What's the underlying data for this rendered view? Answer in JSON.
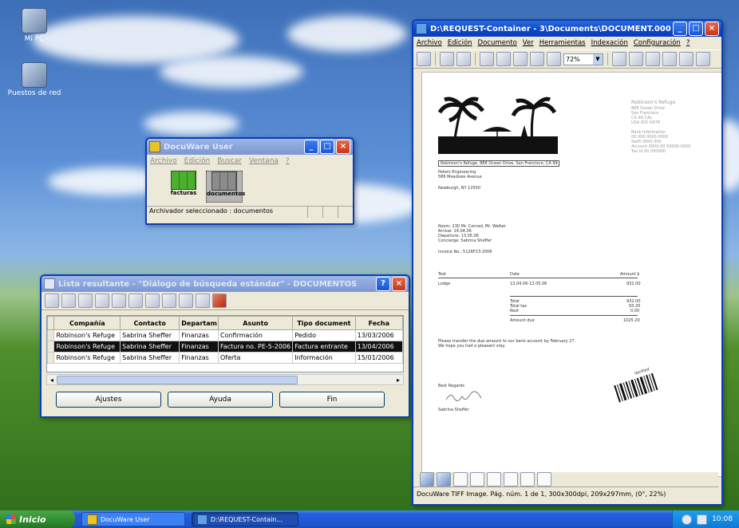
{
  "desktop": {
    "icons": [
      {
        "label": "Mi PC",
        "icon": "computer-icon"
      },
      {
        "label": "Puestos de red",
        "icon": "network-places-icon"
      }
    ]
  },
  "docuware_window": {
    "title": "DocuWare User",
    "menu": [
      "Archivo",
      "Edición",
      "Buscar",
      "Ventana",
      "?"
    ],
    "cabinets": [
      {
        "label": "facturas",
        "icon": "file-cabinet-icon"
      },
      {
        "label": "documentos",
        "icon": "file-cabinet-icon"
      }
    ],
    "status": "Archivador seleccionado : documentos"
  },
  "results_window": {
    "title": "Lista resultante - \"Diálogo de búsqueda estándar\" - DOCUMENTOS",
    "columns": [
      "Compañía",
      "Contacto",
      "Departam",
      "Asunto",
      "Tipo document",
      "Fecha"
    ],
    "rows": [
      [
        "Robinson's Refuge",
        "Sabrina Sheffer",
        "Finanzas",
        "Confirmación",
        "Pedido",
        "13/03/2006"
      ],
      [
        "Robinson's Refuge",
        "Sabrina Sheffer",
        "Finanzas",
        "Factura no. PE-5-2006",
        "Factura entrante",
        "13/04/2006"
      ],
      [
        "Robinson's Refuge",
        "Sabrina Sheffer",
        "Finanzas",
        "Oferta",
        "Información",
        "15/01/2006"
      ]
    ],
    "selected_row": 1,
    "buttons": [
      "Ajustes",
      "Ayuda",
      "Fin"
    ]
  },
  "viewer_window": {
    "title": "D:\\REQUEST-Container - 3\\Documents\\DOCUMENT.000",
    "menu": [
      "Archivo",
      "Edición",
      "Documento",
      "Ver",
      "Herramientas",
      "Indexación",
      "Configuración",
      "?"
    ],
    "zoom": "72%",
    "status": "DocuWare TIFF Image.  Pág. núm. 1 de 1, 300x300dpi, 209x297mm,  (0°, 22%)",
    "document": {
      "sender_line": "Robinson's Refuge, 888 Ocean Drive, San Francisco, CA 99 CAL AB",
      "recipient": [
        "Peters Engineering",
        "586 Meadows Avenue",
        "",
        "Newburgh, NY 12550"
      ],
      "letterhead": [
        "Robinson's Refuge",
        "888 Ocean Drive",
        "San Francisco",
        "CA 99 CAL",
        "USA 001-5678"
      ],
      "letterhead_contact": [
        "Bank Information",
        "00 000 0000 0000",
        "Swift 0000 000",
        "Account 0000 00 00000 0000",
        "Tax id 00 000000"
      ],
      "details": [
        "Room: 230 Mr. Conrad, Mr. Walker",
        "Arrival: 14.04.06",
        "Departure: 13.05.06",
        "Concierge: Sabrina Sheffer"
      ],
      "invoice": "Invoice No.: 5126F23:2006",
      "table_head": [
        "Text",
        "Date",
        "Amount $"
      ],
      "table_row": [
        "Lodge",
        "13.04.06-13.05.06",
        "932.00"
      ],
      "totals": [
        [
          "Total",
          "932.00"
        ],
        [
          "Total tax",
          "93.20"
        ],
        [
          "Rest",
          "0.00"
        ]
      ],
      "grand_total": [
        "Amount due",
        "1025.20"
      ],
      "note": [
        "Please transfer the due amount to our bank account by February 27.",
        "We hope you had a pleasant stay."
      ],
      "closing": "Best Regards",
      "signer": "Sabrina Sheffer",
      "stamp": "Verified"
    }
  },
  "taskbar": {
    "start": "Inicio",
    "tasks": [
      "DocuWare User",
      "D:\\REQUEST-Contain..."
    ],
    "clock": "10:08"
  }
}
